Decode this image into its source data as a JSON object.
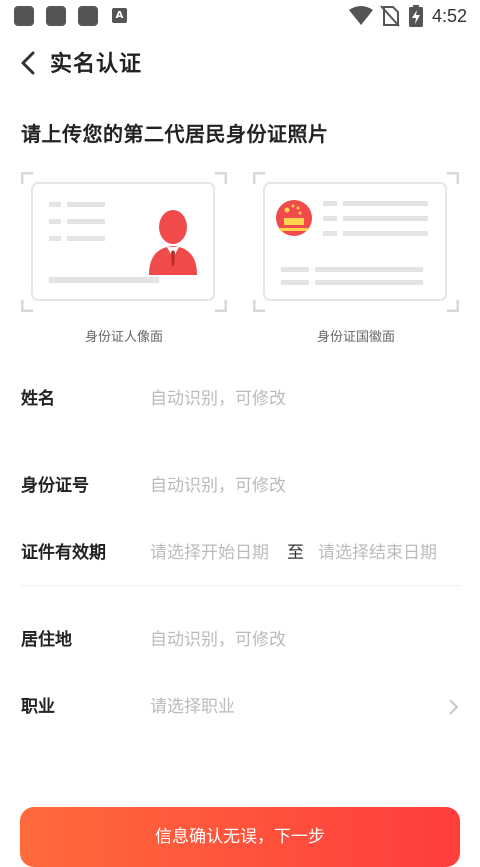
{
  "status_bar": {
    "time": "4:52",
    "app_icon_letter": "A"
  },
  "nav": {
    "title": "实名认证"
  },
  "upload": {
    "heading": "请上传您的第二代居民身份证照片",
    "front_label": "身份证人像面",
    "back_label": "身份证国徽面"
  },
  "form": {
    "name": {
      "label": "姓名",
      "placeholder": "自动识别，可修改"
    },
    "id_number": {
      "label": "身份证号",
      "placeholder": "自动识别，可修改"
    },
    "validity": {
      "label": "证件有效期",
      "start_placeholder": "请选择开始日期",
      "separator": "至",
      "end_placeholder": "请选择结束日期"
    },
    "address": {
      "label": "居住地",
      "placeholder": "自动识别，可修改"
    },
    "occupation": {
      "label": "职业",
      "placeholder": "请选择职业"
    }
  },
  "submit": {
    "label": "信息确认无误，下一步"
  },
  "colors": {
    "accent": "#ff4a3d",
    "emblem": "#f04a4a"
  }
}
